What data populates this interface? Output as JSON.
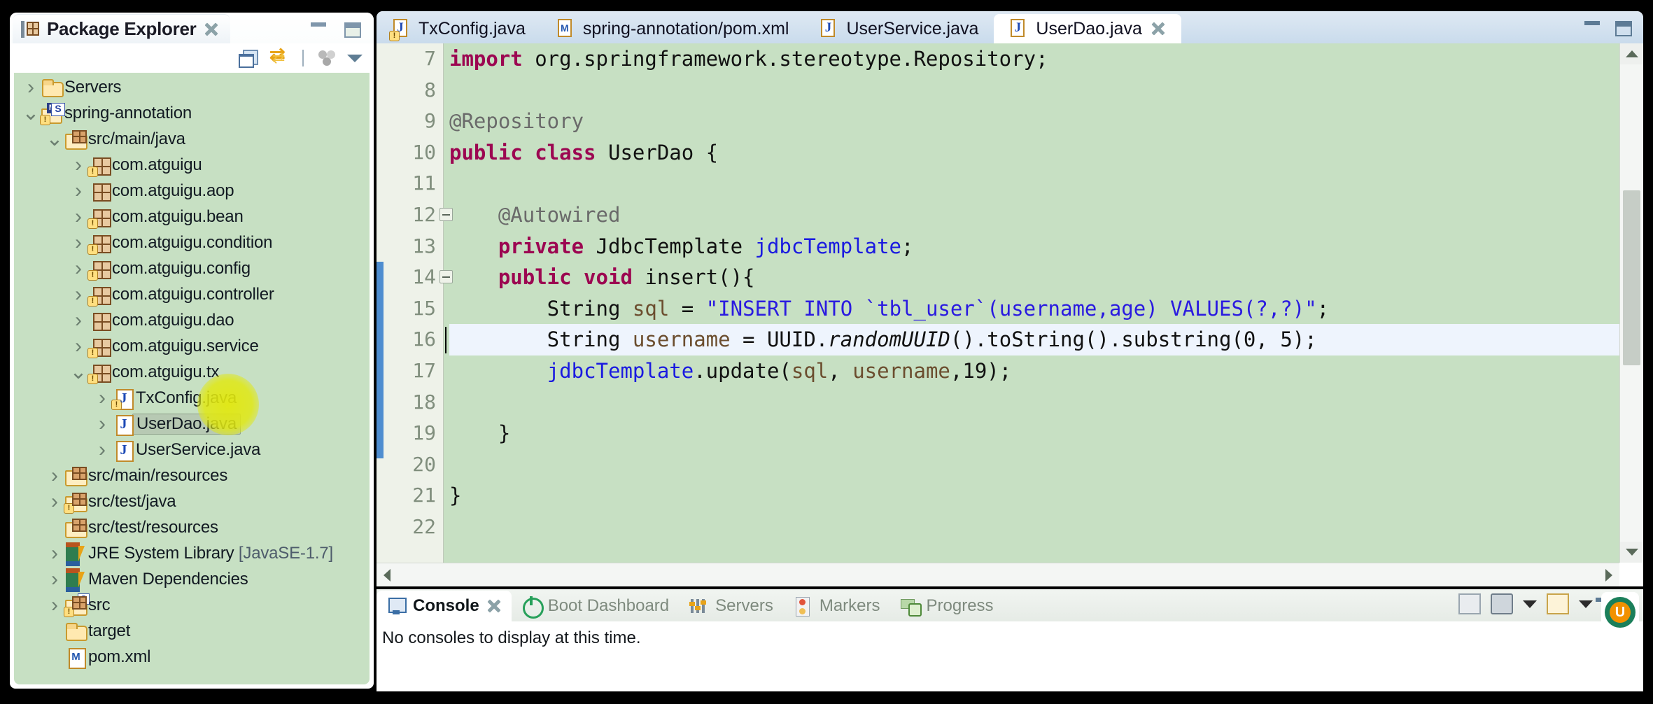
{
  "package_explorer": {
    "title": "Package Explorer",
    "close_icon": "close-icon",
    "toolbar": [
      {
        "name": "collapse-all-icon",
        "label": "Collapse All"
      },
      {
        "name": "link-with-editor-icon",
        "label": "Link with Editor"
      },
      {
        "name": "view-menu-dots-icon",
        "label": "View Menu"
      },
      {
        "name": "view-menu-caret-icon",
        "label": "View Menu"
      }
    ],
    "tree": [
      {
        "label": "Servers",
        "indent": 0,
        "twist": "collapsed",
        "icon": "folder-icon"
      },
      {
        "label": "spring-annotation",
        "indent": 0,
        "twist": "expanded",
        "icon": "maven-project-icon"
      },
      {
        "label": "src/main/java",
        "indent": 1,
        "twist": "expanded",
        "icon": "source-folder-icon"
      },
      {
        "label": "com.atguigu",
        "indent": 2,
        "twist": "collapsed",
        "icon": "package-warn-icon"
      },
      {
        "label": "com.atguigu.aop",
        "indent": 2,
        "twist": "collapsed",
        "icon": "package-icon"
      },
      {
        "label": "com.atguigu.bean",
        "indent": 2,
        "twist": "collapsed",
        "icon": "package-warn-icon"
      },
      {
        "label": "com.atguigu.condition",
        "indent": 2,
        "twist": "collapsed",
        "icon": "package-warn-icon"
      },
      {
        "label": "com.atguigu.config",
        "indent": 2,
        "twist": "collapsed",
        "icon": "package-warn-icon"
      },
      {
        "label": "com.atguigu.controller",
        "indent": 2,
        "twist": "collapsed",
        "icon": "package-warn-icon"
      },
      {
        "label": "com.atguigu.dao",
        "indent": 2,
        "twist": "collapsed",
        "icon": "package-icon"
      },
      {
        "label": "com.atguigu.service",
        "indent": 2,
        "twist": "collapsed",
        "icon": "package-warn-icon"
      },
      {
        "label": "com.atguigu.tx",
        "indent": 2,
        "twist": "expanded",
        "icon": "package-warn-icon"
      },
      {
        "label": "TxConfig.java",
        "indent": 3,
        "twist": "collapsed",
        "icon": "java-warn-icon"
      },
      {
        "label": "UserDao.java",
        "indent": 3,
        "twist": "collapsed",
        "icon": "java-icon",
        "selected": true
      },
      {
        "label": "UserService.java",
        "indent": 3,
        "twist": "collapsed",
        "icon": "java-icon"
      },
      {
        "label": "src/main/resources",
        "indent": 1,
        "twist": "collapsed",
        "icon": "source-folder-icon"
      },
      {
        "label": "src/test/java",
        "indent": 1,
        "twist": "collapsed",
        "icon": "source-folder-warn-icon"
      },
      {
        "label": "src/test/resources",
        "indent": 1,
        "twist": "none",
        "icon": "source-folder-icon"
      },
      {
        "label": "JRE System Library ",
        "suffix": "[JavaSE-1.7]",
        "indent": 1,
        "twist": "collapsed",
        "icon": "library-icon"
      },
      {
        "label": "Maven Dependencies",
        "indent": 1,
        "twist": "collapsed",
        "icon": "library-icon"
      },
      {
        "label": "src",
        "indent": 1,
        "twist": "collapsed",
        "icon": "source-folder-s-icon"
      },
      {
        "label": "target",
        "indent": 1,
        "twist": "none",
        "icon": "folder-icon"
      },
      {
        "label": "pom.xml",
        "indent": 1,
        "twist": "none",
        "icon": "xml-icon"
      }
    ]
  },
  "editor": {
    "tabs": [
      {
        "label": "TxConfig.java",
        "icon": "java-warn-icon",
        "active": false,
        "closable": false
      },
      {
        "label": "spring-annotation/pom.xml",
        "icon": "xml-icon",
        "active": false,
        "closable": false
      },
      {
        "label": "UserService.java",
        "icon": "java-icon",
        "active": false,
        "closable": false
      },
      {
        "label": "UserDao.java",
        "icon": "java-icon",
        "active": true,
        "closable": true
      }
    ],
    "minimize_icon": "minimize-icon",
    "maximize_icon": "maximize-icon",
    "line_numbers": [
      "7",
      "8",
      "9",
      "10",
      "11",
      "12",
      "13",
      "14",
      "15",
      "16",
      "17",
      "18",
      "19",
      "20",
      "21",
      "22"
    ],
    "fold_lines": [
      "12",
      "14"
    ],
    "current_line": "16",
    "code_lines": [
      [
        {
          "t": "import",
          "c": "kw"
        },
        {
          "t": " org.springframework.stereotype.Repository;",
          "c": ""
        }
      ],
      [
        {
          "t": "",
          "c": ""
        }
      ],
      [
        {
          "t": "@Repository",
          "c": "ann"
        }
      ],
      [
        {
          "t": "public class ",
          "c": "kw"
        },
        {
          "t": "UserDao {",
          "c": ""
        }
      ],
      [
        {
          "t": "",
          "c": ""
        }
      ],
      [
        {
          "t": "    @Autowired",
          "c": "ann"
        }
      ],
      [
        {
          "t": "    ",
          "c": ""
        },
        {
          "t": "private",
          "c": "kw"
        },
        {
          "t": " JdbcTemplate ",
          "c": ""
        },
        {
          "t": "jdbcTemplate",
          "c": "fld"
        },
        {
          "t": ";",
          "c": ""
        }
      ],
      [
        {
          "t": "    ",
          "c": ""
        },
        {
          "t": "public void ",
          "c": "kw"
        },
        {
          "t": "insert(){",
          "c": ""
        }
      ],
      [
        {
          "t": "        String ",
          "c": ""
        },
        {
          "t": "sql",
          "c": "prm"
        },
        {
          "t": " = ",
          "c": ""
        },
        {
          "t": "\"INSERT INTO `tbl_user`(username,age) VALUES(?,?)\"",
          "c": "str"
        },
        {
          "t": ";",
          "c": ""
        }
      ],
      [
        {
          "t": "        String ",
          "c": ""
        },
        {
          "t": "username",
          "c": "prm"
        },
        {
          "t": " = UUID.",
          "c": ""
        },
        {
          "t": "randomUUID",
          "c": "stat"
        },
        {
          "t": "().toString().substring(",
          "c": ""
        },
        {
          "t": "0",
          "c": "num"
        },
        {
          "t": ", ",
          "c": ""
        },
        {
          "t": "5",
          "c": "num"
        },
        {
          "t": ");",
          "c": ""
        }
      ],
      [
        {
          "t": "        ",
          "c": ""
        },
        {
          "t": "jdbcTemplate",
          "c": "fld"
        },
        {
          "t": ".update(",
          "c": ""
        },
        {
          "t": "sql",
          "c": "prm"
        },
        {
          "t": ", ",
          "c": ""
        },
        {
          "t": "username",
          "c": "prm"
        },
        {
          "t": ",",
          "c": ""
        },
        {
          "t": "19",
          "c": "num"
        },
        {
          "t": ");",
          "c": ""
        }
      ],
      [
        {
          "t": "",
          "c": ""
        }
      ],
      [
        {
          "t": "    }",
          "c": ""
        }
      ],
      [
        {
          "t": "",
          "c": ""
        }
      ],
      [
        {
          "t": "}",
          "c": ""
        }
      ],
      [
        {
          "t": "",
          "c": ""
        }
      ]
    ],
    "scrollbar": {
      "vertical_icon": "vertical-scrollbar",
      "horizontal_icon": "horizontal-scrollbar"
    }
  },
  "console": {
    "tabs": [
      {
        "label": "Console",
        "icon": "console-icon",
        "active": true,
        "closable": true
      },
      {
        "label": "Boot Dashboard",
        "icon": "boot-dashboard-icon",
        "active": false,
        "closable": false
      },
      {
        "label": "Servers",
        "icon": "servers-icon",
        "active": false,
        "closable": false
      },
      {
        "label": "Markers",
        "icon": "markers-icon",
        "active": false,
        "closable": false
      },
      {
        "label": "Progress",
        "icon": "progress-icon",
        "active": false,
        "closable": false
      }
    ],
    "toolbar": [
      {
        "name": "clear-console-icon"
      },
      {
        "name": "display-selected-console-icon"
      },
      {
        "name": "display-selected-console-caret-icon"
      },
      {
        "name": "open-console-icon"
      },
      {
        "name": "open-console-caret-icon"
      },
      {
        "name": "toolbar-separator"
      },
      {
        "name": "alibaba-coding-guidelines-icon"
      }
    ],
    "message": "No consoles to display at this time.",
    "minimize_icon": "minimize-icon",
    "maximize_icon": "maximize-icon"
  },
  "overlay": {
    "cursor_icon": "mouse-cursor-arrow",
    "click_highlight_icon": "click-highlight-halo",
    "status_badge_icon": "ubuntu-badge-icon"
  },
  "colors": {
    "editor_background": "#c7e0c3",
    "tree_background": "#c7e0c3",
    "keyword": "#9c0651",
    "string": "#2a1ae0",
    "field": "#1a1ae0",
    "annotation": "#6a6a6a",
    "parameter": "#6b4d2e",
    "current_line": "#eef4fd",
    "change_bar": "#4e8dd0",
    "click_highlight": "#e2e80a"
  }
}
